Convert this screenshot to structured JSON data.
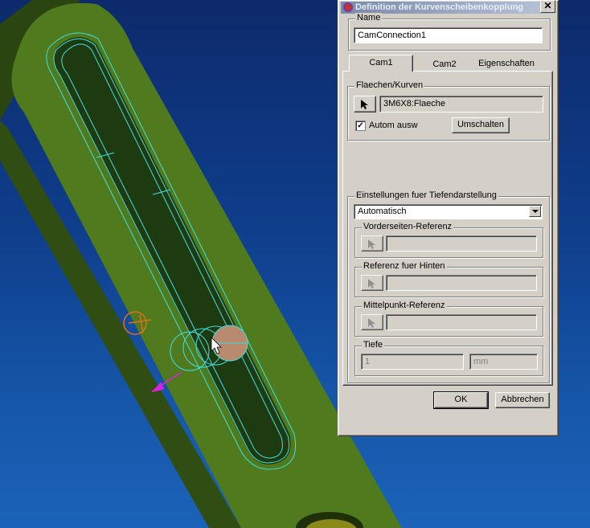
{
  "window": {
    "title": "Definition der Kurvenscheibenkopplung"
  },
  "name_group": {
    "legend": "Name",
    "value": "CamConnection1"
  },
  "tabs": [
    {
      "label": "Cam1",
      "active": true
    },
    {
      "label": "Cam2",
      "active": false
    },
    {
      "label": "Eigenschaften",
      "active": false
    }
  ],
  "surfaces_group": {
    "legend": "Flaechen/Kurven",
    "selection": "3M6X8:Flaeche",
    "auto_select_label": "Autom ausw",
    "auto_select_checked": true,
    "switch_button": "Umschalten"
  },
  "depth_group": {
    "legend": "Einstellungen fuer Tiefendarstellung",
    "mode": "Automatisch",
    "front_ref": {
      "legend": "Vorderseiten-Referenz",
      "value": ""
    },
    "back_ref": {
      "legend": "Referenz fuer Hinten",
      "value": ""
    },
    "center_ref": {
      "legend": "Mittelpunkt-Referenz",
      "value": ""
    },
    "depth": {
      "legend": "Tiefe",
      "value": "1",
      "unit": "mm"
    }
  },
  "footer": {
    "ok": "OK",
    "cancel": "Abbrechen"
  },
  "colors": {
    "background_top": "#0d2a6b",
    "background_bottom": "#1b63b8",
    "part_green": "#4f7a1e",
    "part_dark": "#2a4310",
    "highlight_cyan": "#40e0e0"
  }
}
